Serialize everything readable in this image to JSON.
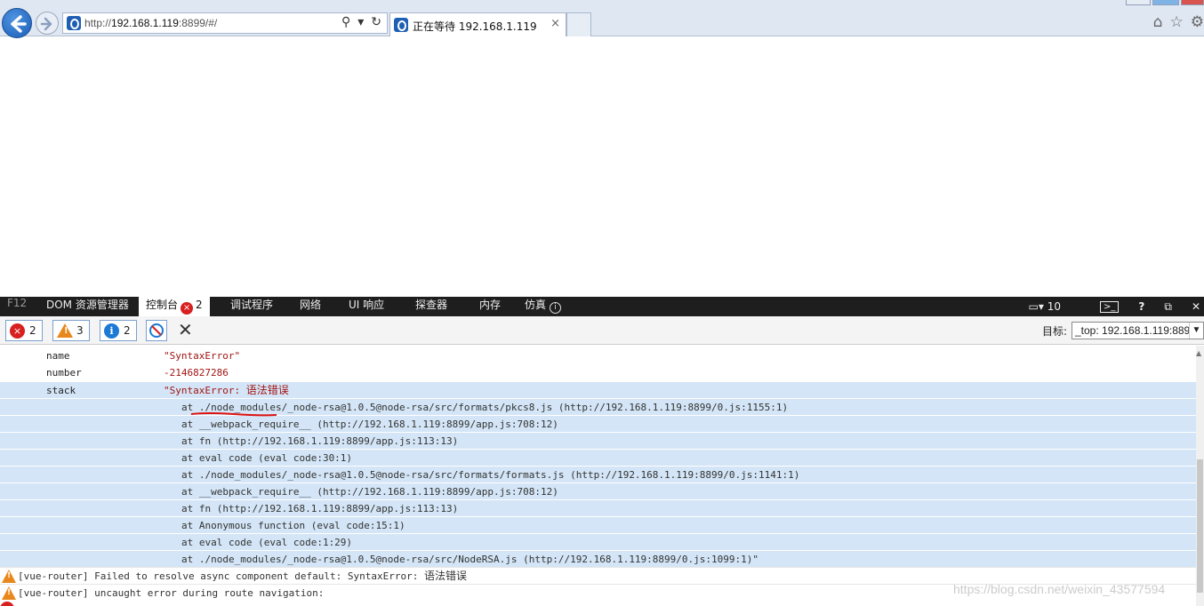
{
  "browser": {
    "url_prefix": "http://",
    "url_host": "192.168.1.119",
    "url_rest": ":8899/#/",
    "tab_title": "正在等待 192.168.1.119",
    "tab_close": "×"
  },
  "devtools": {
    "tabs": [
      "F12",
      "DOM 资源管理器",
      "控制台",
      "调试程序",
      "网络",
      "UI 响应",
      "探查器",
      "内存",
      "仿真"
    ],
    "console_error_badge": "2",
    "emulation_info": "i",
    "zoom_value": "10",
    "right_icons": [
      "?"
    ],
    "error_count": "2",
    "warning_count": "3",
    "info_count": "2",
    "target_label": "目标:",
    "target_value": "_top: 192.168.1.119:8899"
  },
  "console": {
    "props": [
      {
        "name": "name",
        "value": "\"SyntaxError\""
      },
      {
        "name": "number",
        "value": "-2146827286"
      },
      {
        "name": "stack",
        "value": "\"SyntaxError: ",
        "value_cn": "语法错误"
      }
    ],
    "stack_lines": [
      "at ./node_modules/_node-rsa@1.0.5@node-rsa/src/formats/pkcs8.js (http://192.168.1.119:8899/0.js:1155:1)",
      "at __webpack_require__ (http://192.168.1.119:8899/app.js:708:12)",
      "at fn (http://192.168.1.119:8899/app.js:113:13)",
      "at eval code (eval code:30:1)",
      "at ./node_modules/_node-rsa@1.0.5@node-rsa/src/formats/formats.js (http://192.168.1.119:8899/0.js:1141:1)",
      "at __webpack_require__ (http://192.168.1.119:8899/app.js:708:12)",
      "at fn (http://192.168.1.119:8899/app.js:113:13)",
      "at Anonymous function (eval code:15:1)",
      "at eval code (eval code:1:29)",
      "at ./node_modules/_node-rsa@1.0.5@node-rsa/src/NodeRSA.js (http://192.168.1.119:8899/0.js:1099:1)\""
    ],
    "messages": [
      {
        "text": "[vue-router] Failed to resolve async component default: SyntaxError: ",
        "cn": "语法错误"
      },
      {
        "text": "[vue-router] uncaught error during route navigation:",
        "cn": ""
      }
    ]
  },
  "watermark": "https://blog.csdn.net/weixin_43577594"
}
